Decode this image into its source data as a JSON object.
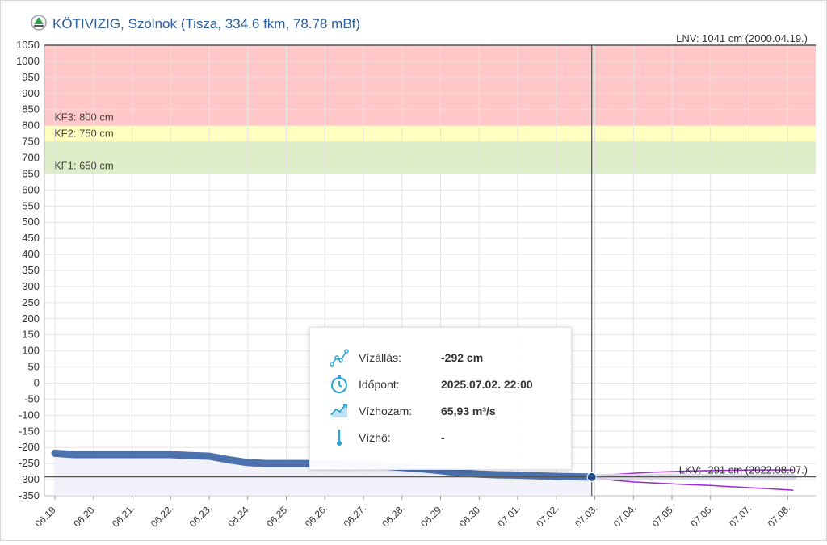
{
  "header": {
    "icon": "station-marker-icon",
    "title": "KÖTIVIZIG, Szolnok (Tisza, 334.6 fkm, 78.78 mBf)"
  },
  "colors": {
    "kf3_band": "#ffc7c7",
    "kf2_band": "#ffffc0",
    "kf1_band": "#dcedc8",
    "observed_line": "#2d5aa0",
    "observed_fill": "#eef0f8",
    "forecast_band": "#9c27d6",
    "forecast_line": "#d8d8e6",
    "reference_line": "#555555"
  },
  "chart_data": {
    "type": "line",
    "y_ticks": [
      1050,
      1000,
      950,
      900,
      850,
      800,
      750,
      700,
      650,
      600,
      550,
      500,
      450,
      400,
      350,
      300,
      250,
      200,
      150,
      100,
      50,
      0,
      -50,
      -100,
      -150,
      -200,
      -250,
      -300,
      -350
    ],
    "ylim": [
      -350,
      1050
    ],
    "x_labels": [
      "06.19.",
      "06.20.",
      "06.21.",
      "06.22.",
      "06.23.",
      "06.24.",
      "06.25.",
      "06.26.",
      "06.27.",
      "06.28.",
      "06.29.",
      "06.30.",
      "07.01.",
      "07.02.",
      "07.03.",
      "07.04.",
      "07.05.",
      "07.06.",
      "07.07.",
      "07.08."
    ],
    "grid": true,
    "bands": [
      {
        "name": "KF3",
        "label": "KF3: 800 cm",
        "from": 800,
        "to": 1050
      },
      {
        "name": "KF2",
        "label": "KF2: 750 cm",
        "from": 750,
        "to": 800
      },
      {
        "name": "KF1",
        "label": "KF1: 650 cm",
        "from": 650,
        "to": 750
      }
    ],
    "reference_lines": [
      {
        "label": "LNV: 1041 cm (2000.04.19.)",
        "value": 1050
      },
      {
        "label": "LKV: -291 cm (2022.08.07.)",
        "value": -291
      }
    ],
    "observed": {
      "x": [
        0,
        0.5,
        1,
        1.5,
        2,
        2.5,
        3,
        3.5,
        4,
        4.5,
        5,
        5.5,
        6,
        6.5,
        7,
        7.5,
        8,
        8.5,
        9,
        9.5,
        10,
        10.5,
        11,
        11.5,
        12,
        12.5,
        13,
        13.5,
        13.92
      ],
      "y": [
        -218,
        -222,
        -222,
        -222,
        -222,
        -222,
        -222,
        -225,
        -227,
        -238,
        -247,
        -250,
        -250,
        -250,
        -250,
        -253,
        -255,
        -258,
        -262,
        -266,
        -272,
        -279,
        -283,
        -285,
        -286,
        -288,
        -290,
        -291,
        -292
      ]
    },
    "forecast": {
      "x": [
        13.92,
        14.5,
        15,
        15.5,
        16,
        16.5,
        17,
        17.5,
        18,
        18.5,
        19,
        19.15
      ],
      "y": [
        -292,
        -292,
        -292,
        -292,
        -292,
        -292,
        -292,
        -292,
        -292,
        -292,
        -292,
        -292
      ],
      "upper": [
        -292,
        -284,
        -280,
        -277,
        -275,
        -273,
        -272,
        -271,
        -270,
        -270,
        -270,
        -270
      ],
      "lower": [
        -292,
        -302,
        -307,
        -310,
        -313,
        -316,
        -318,
        -322,
        -325,
        -328,
        -332,
        -333
      ]
    },
    "crosshair_x": 13.92
  },
  "tooltip": {
    "rows": [
      {
        "icon": "water-level-icon",
        "label": "Vízállás:",
        "value": "-292 cm"
      },
      {
        "icon": "clock-icon",
        "label": "Időpont:",
        "value": "2025.07.02. 22:00"
      },
      {
        "icon": "discharge-icon",
        "label": "Vízhozam:",
        "value": "65,93 m³/s"
      },
      {
        "icon": "thermometer-icon",
        "label": "Vízhő:",
        "value": "-"
      }
    ]
  }
}
